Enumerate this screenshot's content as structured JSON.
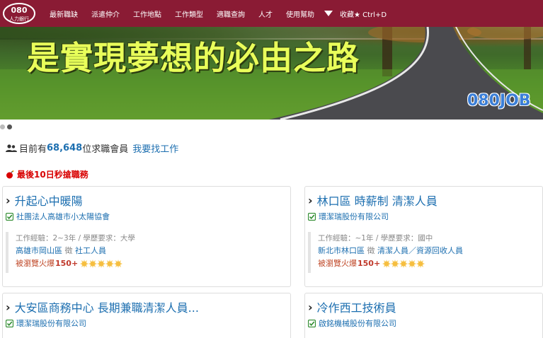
{
  "navbar": {
    "logo_text_top": "080",
    "logo_text_bottom": "人力銀行",
    "items": [
      "最新職缺",
      "派遣仲介",
      "工作地點",
      "工作類型",
      "適職查詢",
      "人才",
      "使用幫助"
    ],
    "favorite": "收藏★ Ctrl+D"
  },
  "banner": {
    "slogan": "是實現夢想的必由之路",
    "brand": "080JOB"
  },
  "slider": {
    "dots": 2,
    "active_index": 1
  },
  "stats": {
    "prefix": "目前有",
    "count": "68,648",
    "suffix": " 位求職會員",
    "link": "我要找工作"
  },
  "urgent": {
    "label": "最後10日秒搶職務"
  },
  "jobs": [
    {
      "title": "升起心中暖陽",
      "company": "社團法人高雄市小太陽協會",
      "experience": "工作經驗：2~3年 / 學歷要求：大學",
      "location": "高雄市岡山區",
      "recruit": "徵",
      "position": "社工人員",
      "hot_label": "被瀏覽火爆",
      "hot_count": "150+",
      "flames": 5
    },
    {
      "title": "林口區 時薪制 清潔人員",
      "company": "環潔瑞股份有限公司",
      "experience": "工作經驗：~1年 / 學歷要求：國中",
      "location": "新北市林口區",
      "recruit": "徵",
      "position": "清潔人員／資源回收人員",
      "hot_label": "被瀏覽火爆",
      "hot_count": "150+",
      "flames": 5
    },
    {
      "title": "大安區商務中心 長期兼職清潔人員...",
      "company": "環潔瑞股份有限公司"
    },
    {
      "title": "冷作西工技術員",
      "company": "啟銘機械股份有限公司"
    }
  ],
  "colors": {
    "navbar": "#8a1b34",
    "link_blue": "#1d6fb0",
    "urgent_red": "#d80000",
    "slogan_yellow": "#e9ff5a"
  }
}
